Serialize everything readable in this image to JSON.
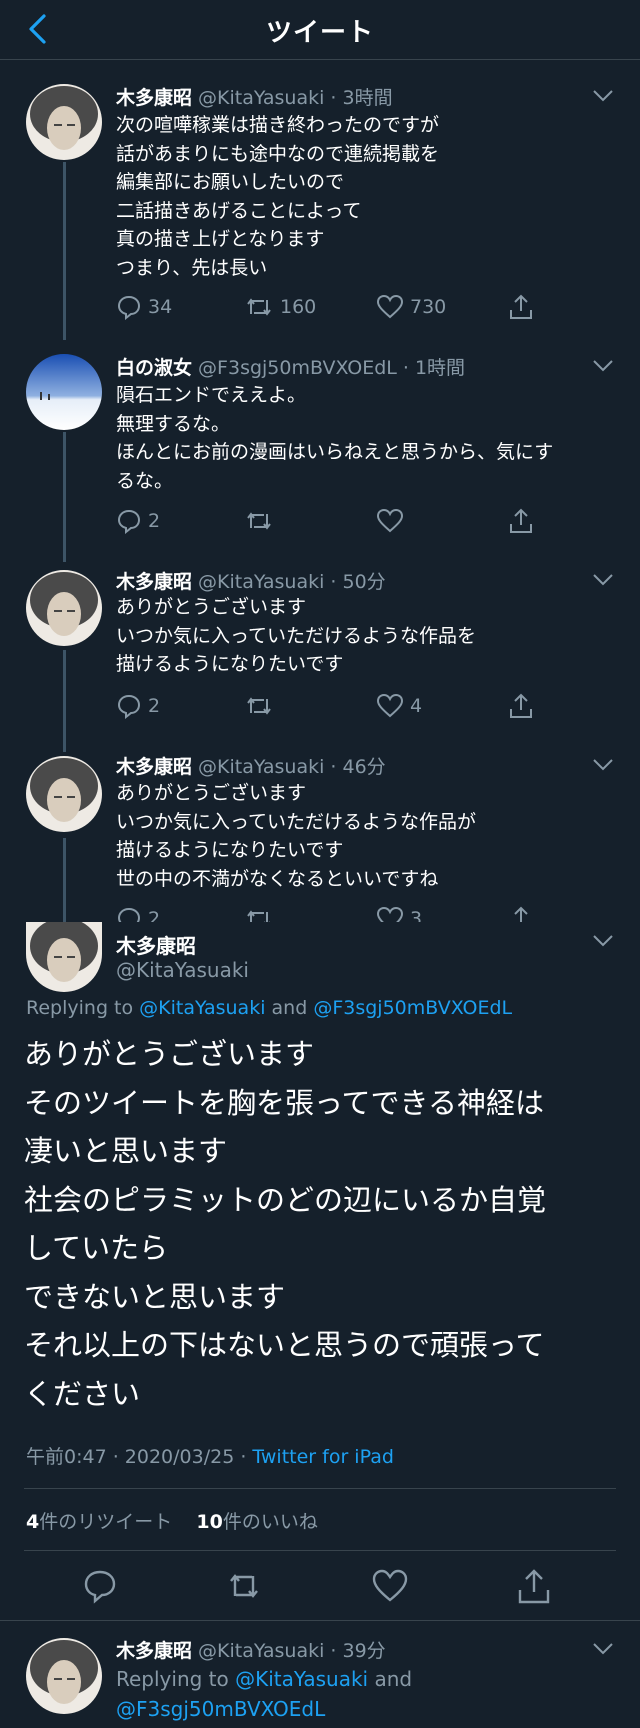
{
  "header": {
    "title": "ツイート"
  },
  "thread": [
    {
      "name": "木多康昭",
      "meta": " @KitaYasuaki · 3時間",
      "lines": [
        "次の喧嘩稼業は描き終わったのですが",
        "話があまりにも途中なので連続掲載を",
        "編集部にお願いしたいので",
        "二話描きあげることによって",
        "真の描き上げとなります",
        "つまり、先は長い"
      ],
      "replies": "34",
      "retweets": "160",
      "likes": "730"
    },
    {
      "name": "白の淑女",
      "meta": " @F3sgj50mBVXOEdL · 1時間",
      "lines": [
        "隕石エンドでええよ。",
        "無理するな。",
        "ほんとにお前の漫画はいらねえと思うから、気にす",
        "るな。"
      ],
      "replies": "2",
      "retweets": "",
      "likes": ""
    },
    {
      "name": "木多康昭",
      "meta": " @KitaYasuaki · 50分",
      "lines": [
        "ありがとうございます",
        "いつか気に入っていただけるような作品を",
        "描けるようになりたいです"
      ],
      "replies": "2",
      "retweets": "",
      "likes": "4"
    },
    {
      "name": "木多康昭",
      "meta": " @KitaYasuaki · 46分",
      "lines": [
        "ありがとうございます",
        "いつか気に入っていただけるような作品が",
        "描けるようになりたいです",
        "世の中の不満がなくなるといいですね"
      ],
      "replies": "2",
      "retweets": "",
      "likes": "3"
    }
  ],
  "main": {
    "name": "木多康昭",
    "handle": "@KitaYasuaki",
    "replying_prefix": "Replying to ",
    "replying_user1": "@KitaYasuaki",
    "replying_and": " and ",
    "replying_user2": "@F3sgj50mBVXOEdL",
    "lines": [
      "ありがとうございます",
      "そのツイートを胸を張ってできる神経は",
      "凄いと思います",
      "社会のピラミットのどの辺にいるか自覚",
      "していたら",
      "できないと思います",
      "それ以上の下はないと思うので頑張って",
      "ください"
    ],
    "timestamp": "午前0:47 · 2020/03/25 · ",
    "source": "Twitter for iPad",
    "retweet_count": "4",
    "retweet_label": "件のリツイート",
    "like_count": "10",
    "like_label": "件のいいね"
  },
  "next_reply": {
    "name": "木多康昭",
    "meta": " @KitaYasuaki · 39分",
    "replying_prefix": "Replying to ",
    "replying_user1": "@KitaYasuaki",
    "replying_and": " and",
    "replying_user2": "@F3sgj50mBVXOEdL"
  },
  "colors": {
    "background": "#15202b",
    "accent": "#1da1f2",
    "muted": "#8899a6",
    "divider": "#38444d"
  }
}
